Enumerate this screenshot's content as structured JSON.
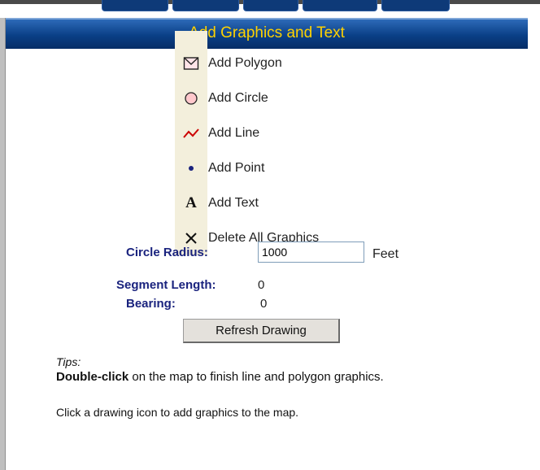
{
  "panel": {
    "title": "Add Graphics and Text"
  },
  "tools": [
    {
      "label": "Add Polygon",
      "icon": "polygon-icon"
    },
    {
      "label": "Add Circle",
      "icon": "circle-icon"
    },
    {
      "label": "Add Line",
      "icon": "line-icon"
    },
    {
      "label": "Add Point",
      "icon": "point-icon"
    },
    {
      "label": "Add Text",
      "icon": "text-icon"
    },
    {
      "label": "Delete All Graphics",
      "icon": "delete-icon"
    }
  ],
  "fields": {
    "circle_radius_label": "Circle Radius:",
    "circle_radius_value": "1000",
    "circle_radius_unit": "Feet",
    "segment_length_label": "Segment Length:",
    "segment_length_value": "0",
    "bearing_label": "Bearing:",
    "bearing_value": "0"
  },
  "refresh_label": "Refresh Drawing",
  "tips": {
    "title": "Tips:",
    "tip1_bold": "Double-click",
    "tip1_rest": " on the map to finish line and polygon graphics.",
    "tip2": "Click a drawing icon to add graphics to the map."
  },
  "colors": {
    "header_blue": "#0a3f86",
    "header_text": "#ffd200",
    "label_navy": "#1a237e",
    "line_red": "#cc0000"
  }
}
